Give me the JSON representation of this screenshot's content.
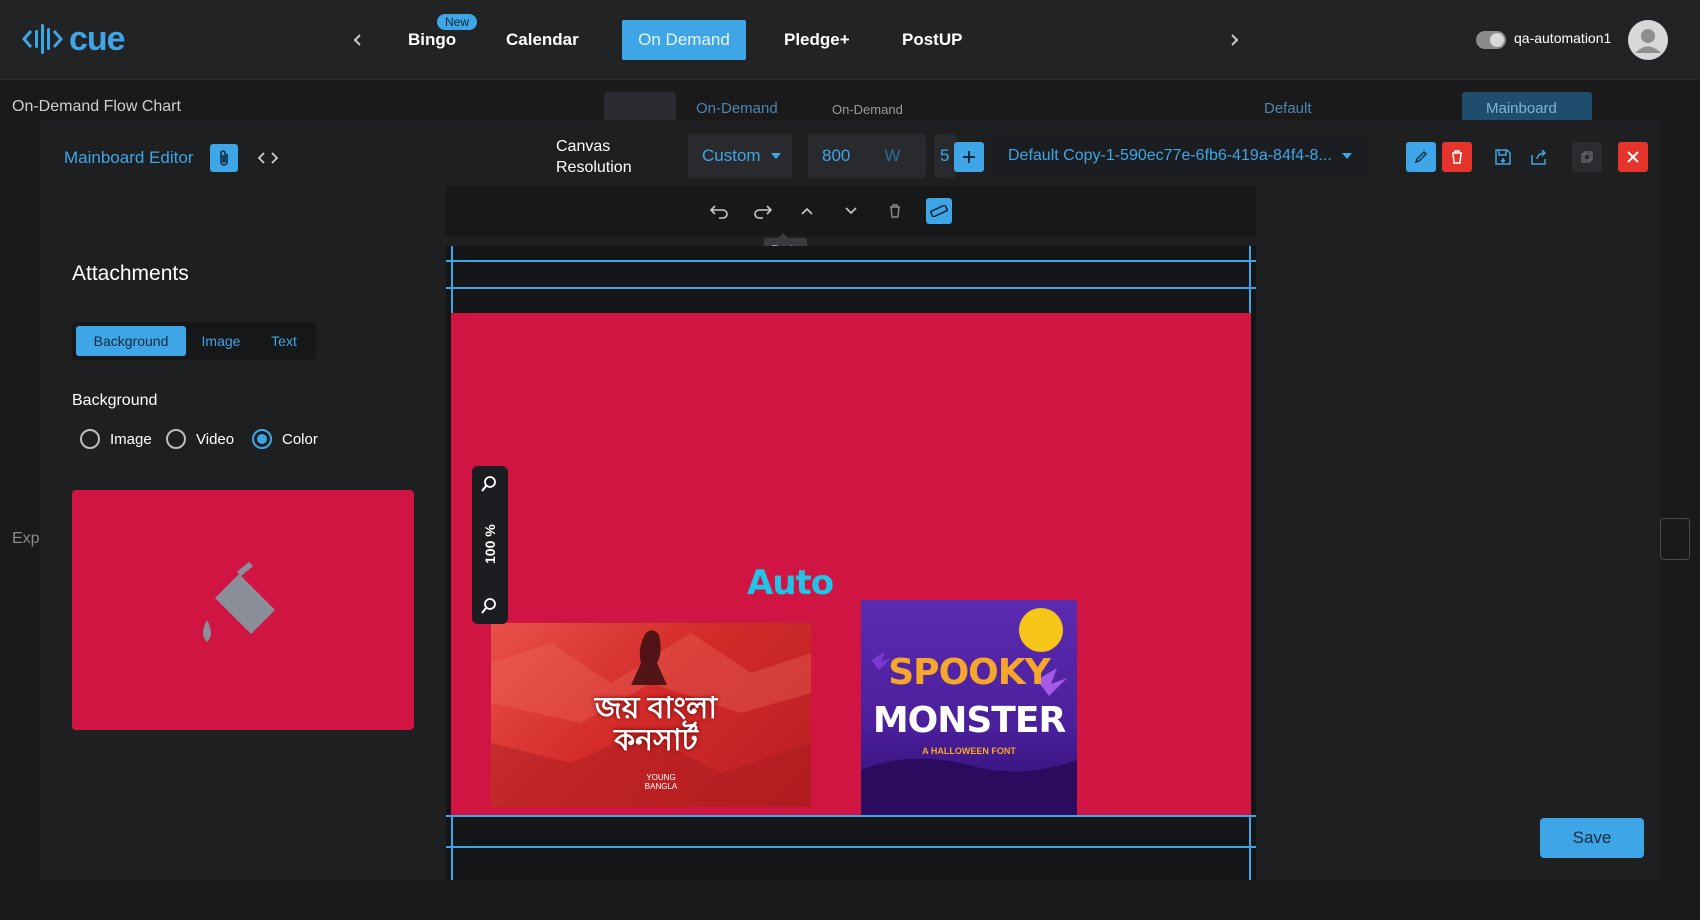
{
  "app": {
    "logo_text": "cue"
  },
  "topnav": {
    "tabs": [
      {
        "label": "Bingo",
        "badge": "New"
      },
      {
        "label": "Calendar"
      },
      {
        "label": "On Demand",
        "active": true
      },
      {
        "label": "Pledge+"
      },
      {
        "label": "PostUP"
      }
    ],
    "username": "qa-automation1"
  },
  "background_page": {
    "title": "On-Demand Flow Chart",
    "dropdown1": "On-Demand",
    "dropdown2": "On-Demand",
    "layout_select": "Default",
    "mainboard_tab": "Mainboard",
    "exp_label": "Exp"
  },
  "modal": {
    "title": "Mainboard Editor",
    "canvas_resolution_label": "Canvas Resolution",
    "resolution_preset": "Custom",
    "width_value": "800",
    "width_unit": "W",
    "height_value": "5",
    "layout_name": "Default Copy-1-590ec77e-6fb6-419a-84f4-8...",
    "toolbar_tooltip": "Redo",
    "zoom_level": "100 %",
    "save_label": "Save"
  },
  "attachments": {
    "title": "Attachments",
    "tabs": [
      "Background",
      "Image",
      "Text"
    ],
    "active_tab": "Background",
    "background_label": "Background",
    "options": [
      "Image",
      "Video",
      "Color"
    ],
    "selected_option": "Color",
    "color": "#d01543"
  },
  "canvas": {
    "background_color": "#d01543",
    "text_element": "Auto",
    "images": [
      {
        "name": "concert-image",
        "text": "জয় বাংলা কনসার্ট",
        "subtext": "YOUNG BANGLA"
      },
      {
        "name": "spooky-monster-image",
        "title1": "SPOOKY",
        "title2": "MONSTER",
        "subtitle": "A HALLOWEEN FONT"
      }
    ]
  },
  "colors": {
    "accent": "#3ea6e6",
    "danger": "#e5342b",
    "canvas": "#d01543"
  }
}
